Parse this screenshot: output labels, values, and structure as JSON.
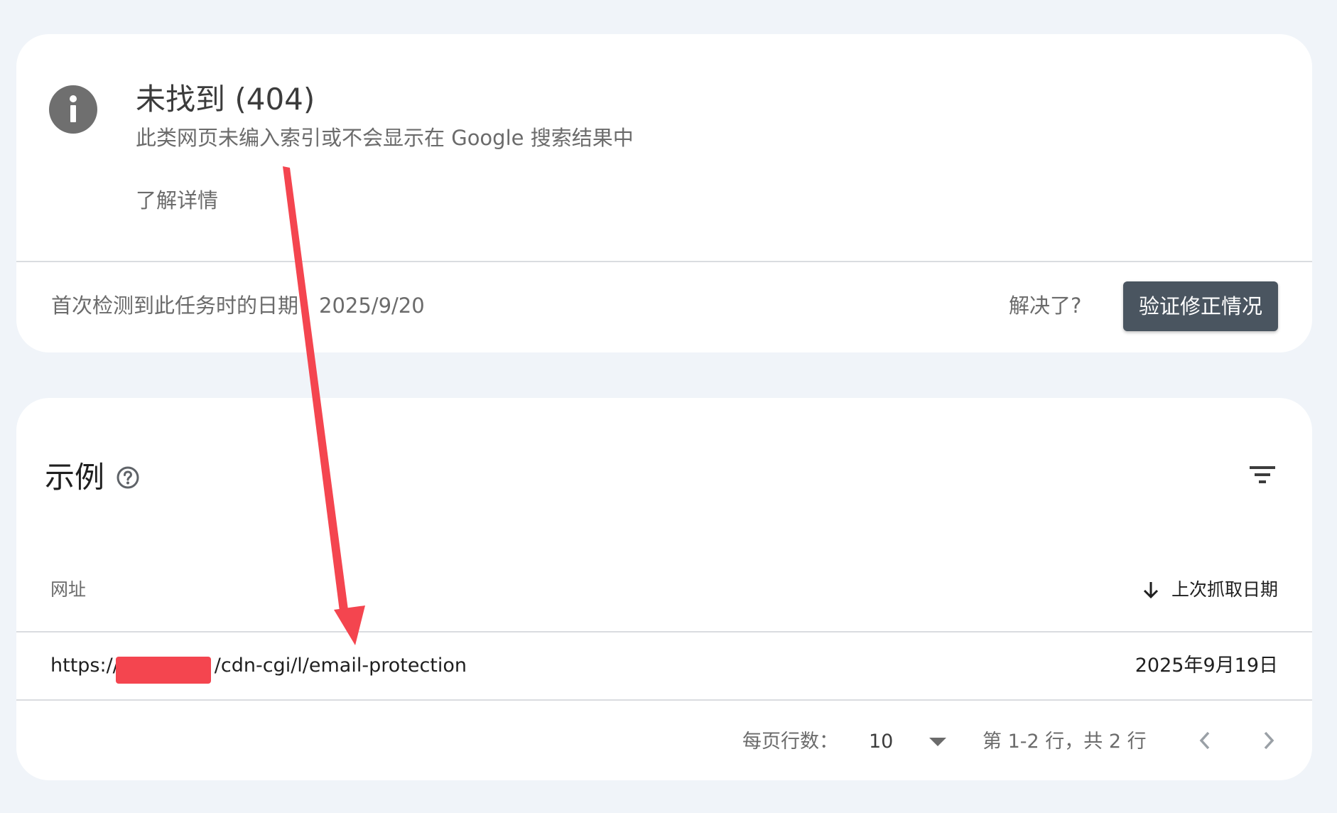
{
  "issue": {
    "title": "未找到 (404)",
    "subtitle": "此类网页未编入索引或不会显示在 Google 搜索结果中",
    "learn_more": "了解详情",
    "first_detected": "首次检测到此任务时的日期：2025/9/20",
    "resolved_label": "解决了?",
    "validate_button": "验证修正情况"
  },
  "examples": {
    "title": "示例",
    "columns": {
      "url": "网址",
      "last_crawled": "上次抓取日期"
    },
    "rows": [
      {
        "url_prefix": "https://",
        "url_suffix": "/cdn-cgi/l/email-protection",
        "last_crawled": "2025年9月19日"
      }
    ],
    "pagination": {
      "rows_per_page_label": "每页行数：",
      "rows_per_page_value": "10",
      "range_label": "第 1-2 行，共 2 行"
    }
  },
  "colors": {
    "background": "#f0f4f9",
    "card": "#ffffff",
    "button": "#4a5560",
    "info_icon": "#6f6f6f",
    "annotation_arrow": "#f4454f",
    "redaction": "#f4454f"
  },
  "icons": {
    "issue": "info-icon",
    "help": "help-icon",
    "filter": "filter-icon",
    "sort": "arrow-down-icon",
    "dropdown": "dropdown-arrow-icon",
    "prev": "chevron-left-icon",
    "next": "chevron-right-icon"
  }
}
